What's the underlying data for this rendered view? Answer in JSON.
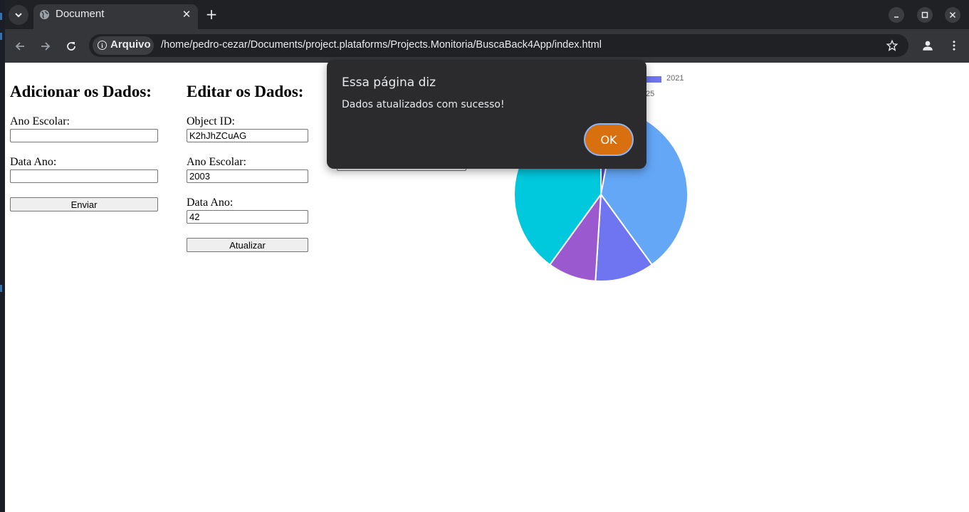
{
  "browser": {
    "tab_title": "Document",
    "address_chip": "Arquivo",
    "url": "/home/pedro-cezar/Documents/project.plataforms/Projects.Monitoria/BuscaBack4App/index.html"
  },
  "add_form": {
    "title": "Adicionar os Dados:",
    "ano_escolar_label": "Ano Escolar:",
    "ano_escolar_value": "",
    "data_ano_label": "Data Ano:",
    "data_ano_value": "",
    "submit_label": "Enviar"
  },
  "edit_form": {
    "title": "Editar os Dados:",
    "object_id_label": "Object ID:",
    "object_id_value": "K2hJhZCuAG",
    "ano_escolar_label": "Ano Escolar:",
    "ano_escolar_value": "2003",
    "data_ano_label": "Data Ano:",
    "data_ano_value": "42",
    "submit_label": "Atualizar"
  },
  "dialog": {
    "title": "Essa página diz",
    "message": "Dados atualizados com sucesso!",
    "ok_label": "OK"
  },
  "chart_data": {
    "type": "pie",
    "visible_legend": [
      {
        "label": "2021",
        "color": "#6f74f0"
      },
      {
        "label": "25",
        "color": "#ffffff"
      }
    ],
    "slices": [
      {
        "color": "#4b50d6",
        "value": 3
      },
      {
        "color": "#64a7f7",
        "value": 37
      },
      {
        "color": "#6f74f0",
        "value": 11
      },
      {
        "color": "#9b59d0",
        "value": 9
      },
      {
        "color": "#00c8dd",
        "value": 40
      }
    ]
  },
  "colors": {
    "dialog_bg": "#2b2b2d",
    "ok_button": "#d9700f",
    "browser_dark": "#202124"
  }
}
